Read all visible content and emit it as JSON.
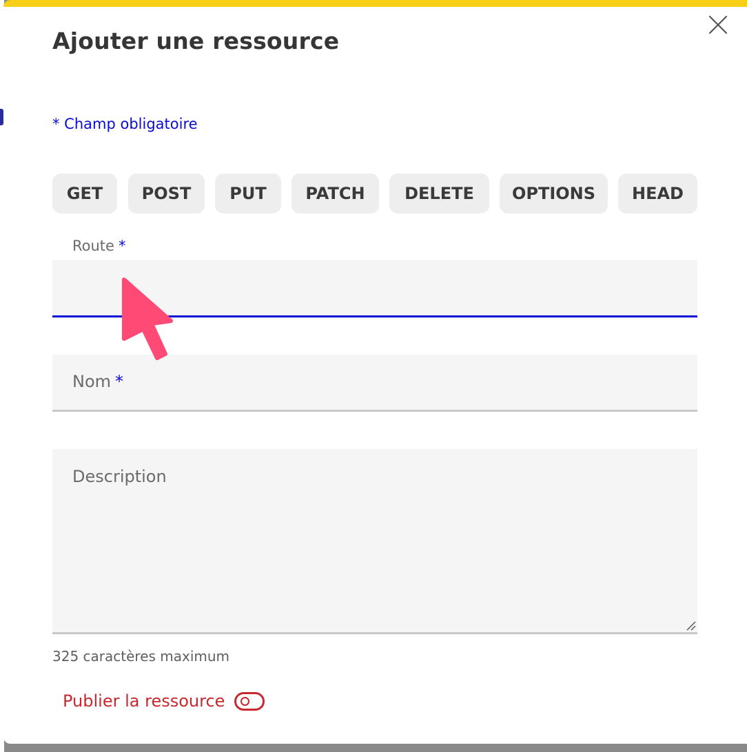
{
  "modal": {
    "title": "Ajouter une ressource",
    "required_note": "* Champ obligatoire",
    "accent_color": "#f7cf17",
    "link_color": "#0b0bd8",
    "danger_color": "#c8282e"
  },
  "methods": [
    {
      "label": "GET"
    },
    {
      "label": "POST"
    },
    {
      "label": "PUT"
    },
    {
      "label": "PATCH"
    },
    {
      "label": "DELETE"
    },
    {
      "label": "OPTIONS"
    },
    {
      "label": "HEAD"
    }
  ],
  "form": {
    "route": {
      "label": "Route",
      "required_marker": "*",
      "value": "",
      "state": "focused"
    },
    "nom": {
      "label": "Nom",
      "required_marker": "*",
      "value": ""
    },
    "description": {
      "label": "Description",
      "value": ""
    },
    "char_limit": "325 caractères maximum",
    "publish_label": "Publier la ressource",
    "publish_enabled": false
  },
  "icons": {
    "close": "close-icon",
    "cursor": "mouse-pointer-icon"
  }
}
